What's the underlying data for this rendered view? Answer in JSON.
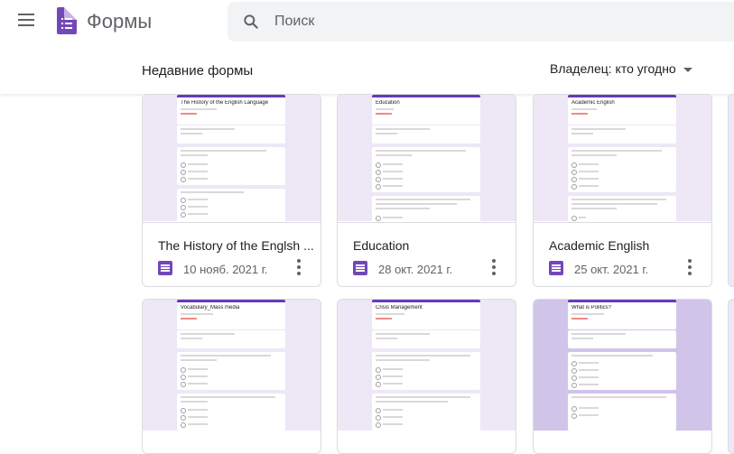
{
  "app": {
    "title": "Формы"
  },
  "search": {
    "placeholder": "Поиск"
  },
  "section": {
    "title": "Недавние формы",
    "owner_filter": "Владелец: кто угодно"
  },
  "forms": [
    {
      "title": "The History of the Englsh ...",
      "date": "10 нояб. 2021 г.",
      "preview_title": "The History of the English Language"
    },
    {
      "title": "Education",
      "date": "28 окт. 2021 г.",
      "preview_title": "Education"
    },
    {
      "title": "Academic English",
      "date": "25 окт. 2021 г.",
      "preview_title": "Academic English"
    },
    {
      "preview_title": "Vocabulary_Mass media"
    },
    {
      "preview_title": "Crisis Management"
    },
    {
      "preview_title": "What is Politics?"
    }
  ],
  "colors": {
    "brand": "#7248b9",
    "accent": "#673ab7",
    "thumb_bg": "#ede7f6"
  },
  "icons": [
    "menu-icon",
    "forms-logo-icon",
    "search-icon",
    "caret-down-icon",
    "forms-file-icon",
    "more-vert-icon"
  ]
}
